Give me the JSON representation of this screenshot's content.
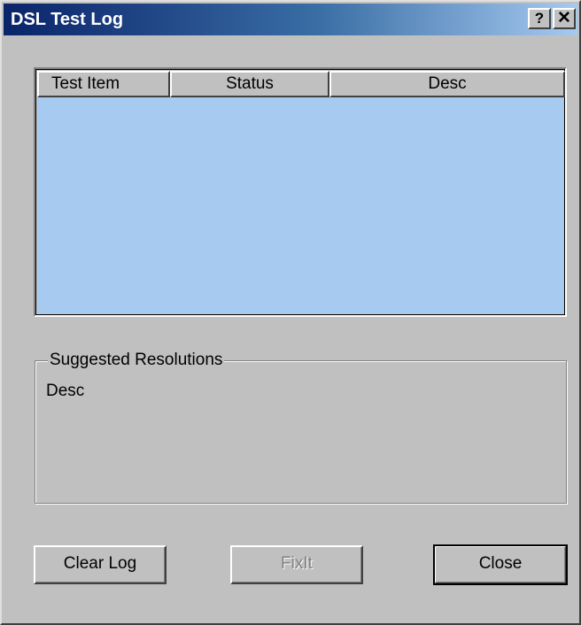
{
  "window": {
    "title": "DSL Test Log",
    "help_glyph": "?",
    "close_glyph": "✕"
  },
  "listview": {
    "columns": [
      "Test Item",
      "Status",
      "Desc"
    ],
    "rows": []
  },
  "resolutions": {
    "label": "Suggested Resolutions",
    "text": "Desc"
  },
  "buttons": {
    "clear_log": "Clear Log",
    "fix_it": "FixIt",
    "close": "Close"
  },
  "colors": {
    "titlebar_start": "#0a246a",
    "titlebar_end": "#a6caf0",
    "list_background": "#a6caf0",
    "dialog_face": "#c0c0c0",
    "disabled_text": "#808080"
  }
}
